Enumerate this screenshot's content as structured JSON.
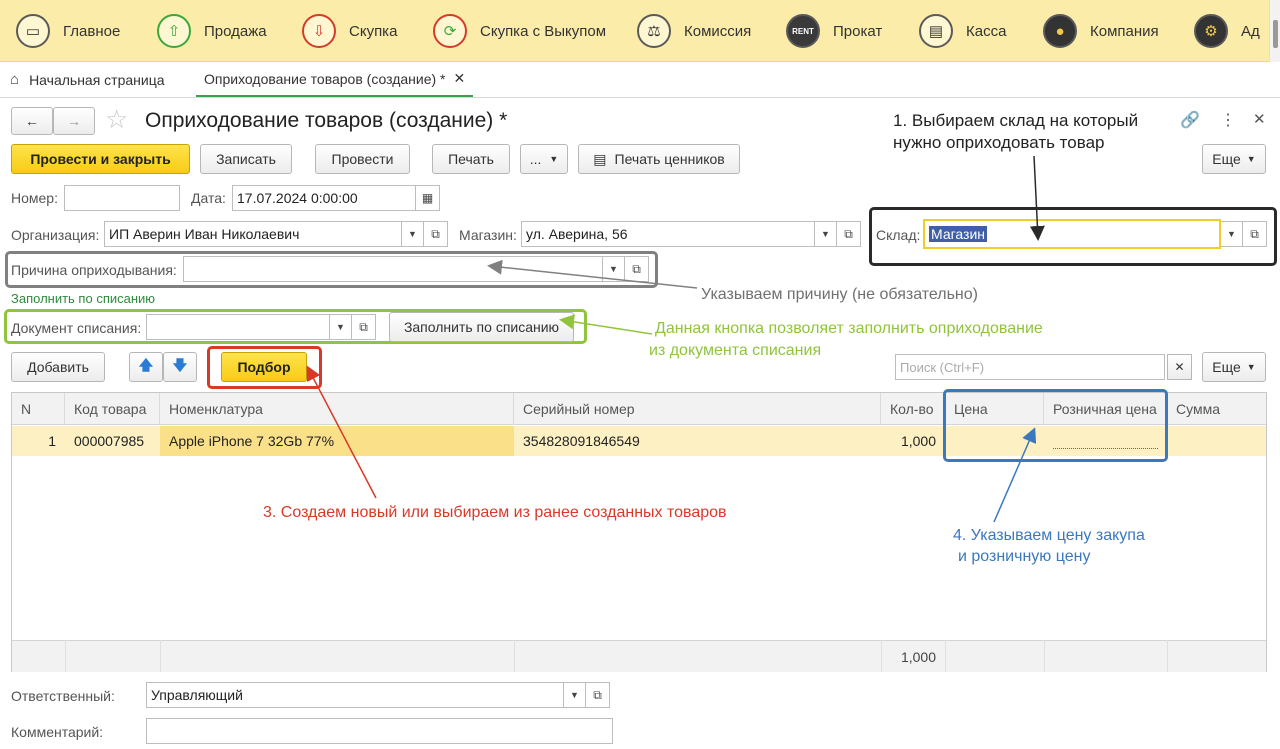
{
  "nav": {
    "items": [
      {
        "label": "Главное",
        "icon": "register-icon"
      },
      {
        "label": "Продажа",
        "icon": "cart-up-icon"
      },
      {
        "label": "Скупка",
        "icon": "cart-down-icon"
      },
      {
        "label": "Скупка с Выкупом",
        "icon": "cycle-icon"
      },
      {
        "label": "Комиссия",
        "icon": "scales-icon"
      },
      {
        "label": "Прокат",
        "icon": "rent-icon"
      },
      {
        "label": "Касса",
        "icon": "cash-register-icon"
      },
      {
        "label": "Компания",
        "icon": "company-icon"
      },
      {
        "label": "Ад",
        "icon": "admin-icon"
      }
    ],
    "rent_badge": "RENT"
  },
  "tabs": {
    "home": "Начальная страница",
    "doc": "Оприходование товаров (создание) *"
  },
  "form": {
    "title": "Оприходование товаров (создание) *",
    "toolbar": {
      "post_close": "Провести и закрыть",
      "save": "Записать",
      "post": "Провести",
      "print": "Печать",
      "more_dots": "...",
      "price_tags": "Печать ценников",
      "more": "Еще"
    },
    "number_label": "Номер:",
    "number_value": "",
    "date_label": "Дата:",
    "date_value": "17.07.2024  0:00:00",
    "org_label": "Организация:",
    "org_value": "ИП Аверин Иван Николаевич",
    "shop_label": "Магазин:",
    "shop_value": "ул. Аверина, 56",
    "warehouse_label": "Склад:",
    "warehouse_value": "Магазин",
    "reason_label": "Причина оприходывания:",
    "reason_value": "",
    "fill_link": "Заполнить по списанию",
    "writeoff_label": "Документ списания:",
    "writeoff_value": "",
    "fill_button": "Заполнить по списанию",
    "add_button": "Добавить",
    "pick_button": "Подбор",
    "search_placeholder": "Поиск (Ctrl+F)",
    "more2": "Еще",
    "responsible_label": "Ответственный:",
    "responsible_value": "Управляющий",
    "comment_label": "Комментарий:",
    "comment_value": ""
  },
  "table": {
    "columns": [
      "N",
      "Код товара",
      "Номенклатура",
      "Серийный номер",
      "Кол-во",
      "Цена",
      "Розничная цена",
      "Сумма"
    ],
    "rows": [
      {
        "n": "1",
        "code": "000007985",
        "name": "Apple iPhone 7 32Gb 77%",
        "serial": "354828091846549",
        "qty": "1,000",
        "price": "",
        "retail": "",
        "sum": ""
      }
    ],
    "footer_qty": "1,000"
  },
  "annotations": {
    "a1_line1": "1. Выбираем склад на который",
    "a1_line2": "нужно оприходовать товар",
    "a2": "Указываем причину (не обязательно)",
    "a3_line1": "Данная кнопка позволяет заполнить оприходование",
    "a3_line2": "из документа списания",
    "a4": "3. Создаем новый или выбираем из ранее созданных товаров",
    "a5_line1": "4. Указываем цену закупа",
    "a5_line2": "и розничную цену"
  },
  "colors": {
    "nav_bg": "#fbeca9",
    "primary_yellow": "#f7cc14",
    "annot_black": "#2a2a2a",
    "annot_gray": "#808080",
    "annot_green": "#8fc43c",
    "annot_red": "#d83a2a",
    "annot_blue": "#3a78c0",
    "row_highlight": "#fdf1c4"
  }
}
